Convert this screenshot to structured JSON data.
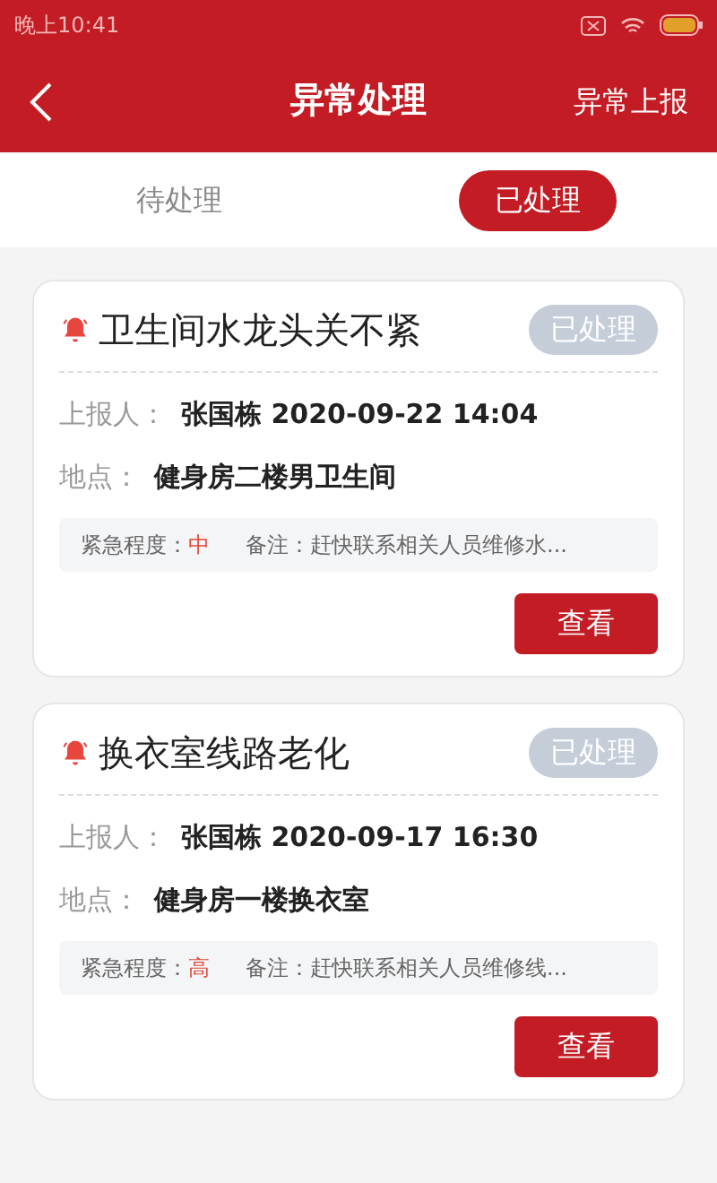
{
  "status_bar": {
    "time": "晚上10:41"
  },
  "header": {
    "title": "异常处理",
    "action": "异常上报"
  },
  "tabs": [
    {
      "label": "待处理",
      "selected": false
    },
    {
      "label": "已处理",
      "selected": true
    }
  ],
  "reports": [
    {
      "title": "卫生间水龙头关不紧",
      "status": "已处理",
      "reporter_label": "上报人：",
      "reporter": "张国栋 2020-09-22 14:04",
      "location_label": "地点：",
      "location": "健身房二楼男卫生间",
      "urgency_label": "紧急程度：",
      "urgency": "中",
      "note_label": "备注：",
      "note": "赶快联系相关人员维修水...",
      "button": "查看"
    },
    {
      "title": "换衣室线路老化",
      "status": "已处理",
      "reporter_label": "上报人：",
      "reporter": "张国栋 2020-09-17 16:30",
      "location_label": "地点：",
      "location": "健身房一楼换衣室",
      "urgency_label": "紧急程度：",
      "urgency": "高",
      "note_label": "备注：",
      "note": "赶快联系相关人员维修线...",
      "button": "查看"
    }
  ]
}
